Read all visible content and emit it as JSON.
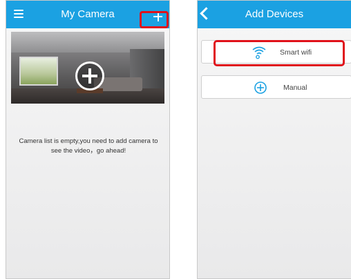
{
  "left_screen": {
    "title": "My Camera",
    "empty_message": "Camera list is empty,you need to add camera to see the video，go ahead!"
  },
  "right_screen": {
    "title": "Add Devices",
    "options": [
      {
        "label": "Smart wifi",
        "icon": "wifi-icon"
      },
      {
        "label": "Manual",
        "icon": "add-circle-icon"
      }
    ]
  },
  "colors": {
    "appbar": "#1ba1e2",
    "highlight": "#e0111a"
  }
}
